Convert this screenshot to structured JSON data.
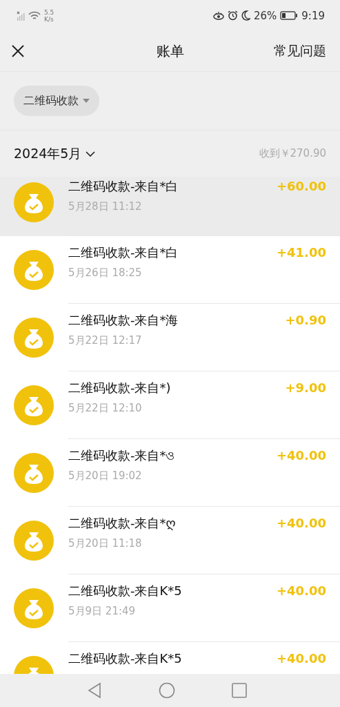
{
  "status_bar": {
    "speed_value": "5.5",
    "speed_unit": "K/s",
    "battery": "26%",
    "time": "9:19"
  },
  "header": {
    "title": "账单",
    "action": "常见问题"
  },
  "filter": {
    "label": "二维码收款"
  },
  "month": {
    "label": "2024年5月",
    "summary": "收到￥270.90"
  },
  "transactions": [
    {
      "title": "二维码收款-来自*白",
      "time": "5月28日 11:12",
      "amount": "+60.00",
      "pressed": true
    },
    {
      "title": "二维码收款-来自*白",
      "time": "5月26日 18:25",
      "amount": "+41.00",
      "pressed": false
    },
    {
      "title": "二维码收款-来自*海",
      "time": "5月22日 12:17",
      "amount": "+0.90",
      "pressed": false
    },
    {
      "title": "二维码收款-来自*)",
      "time": "5月22日 12:10",
      "amount": "+9.00",
      "pressed": false
    },
    {
      "title": "二维码收款-来自*ও",
      "time": "5月20日 19:02",
      "amount": "+40.00",
      "pressed": false
    },
    {
      "title": "二维码收款-来自*ღ",
      "time": "5月20日 11:18",
      "amount": "+40.00",
      "pressed": false
    },
    {
      "title": "二维码收款-来自K*5",
      "time": "5月9日 21:49",
      "amount": "+40.00",
      "pressed": false
    },
    {
      "title": "二维码收款-来自K*5",
      "amount": "+40.00",
      "pressed": false
    }
  ]
}
